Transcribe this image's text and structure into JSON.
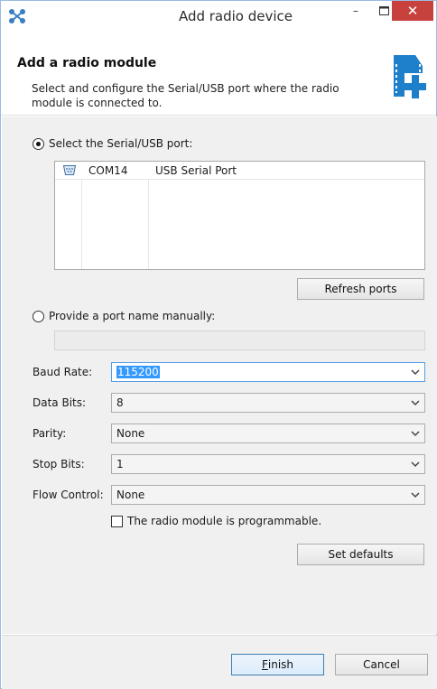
{
  "window": {
    "title": "Add radio device",
    "minimize_glyph": "–",
    "close_glyph": "✕"
  },
  "header": {
    "title": "Add a radio module",
    "description": "Select and configure the Serial/USB port where the radio module is connected to.",
    "icon": "xbee-add-icon"
  },
  "port_selection": {
    "select_port_label": "Select the Serial/USB port:",
    "selected": "select",
    "ports": [
      {
        "name": "COM14",
        "description": "USB Serial Port",
        "icon": "serial-port-icon"
      }
    ],
    "refresh_label": "Refresh ports",
    "manual_label": "Provide a port name manually:",
    "manual_value": ""
  },
  "settings": {
    "baud_rate": {
      "label": "Baud Rate:",
      "value": "115200"
    },
    "data_bits": {
      "label": "Data Bits:",
      "value": "8"
    },
    "parity": {
      "label": "Parity:",
      "value": "None"
    },
    "stop_bits": {
      "label": "Stop Bits:",
      "value": "1"
    },
    "flow_control": {
      "label": "Flow Control:",
      "value": "None"
    }
  },
  "programmable": {
    "label": "The radio module is programmable.",
    "checked": false
  },
  "set_defaults_label": "Set defaults",
  "footer": {
    "finish_mnemonic": "F",
    "finish_rest": "inish",
    "cancel_label": "Cancel"
  },
  "colors": {
    "close_button": "#c7423d",
    "selection": "#3399ff",
    "focus_border": "#569de5",
    "icon_blue": "#1e7fcb"
  }
}
